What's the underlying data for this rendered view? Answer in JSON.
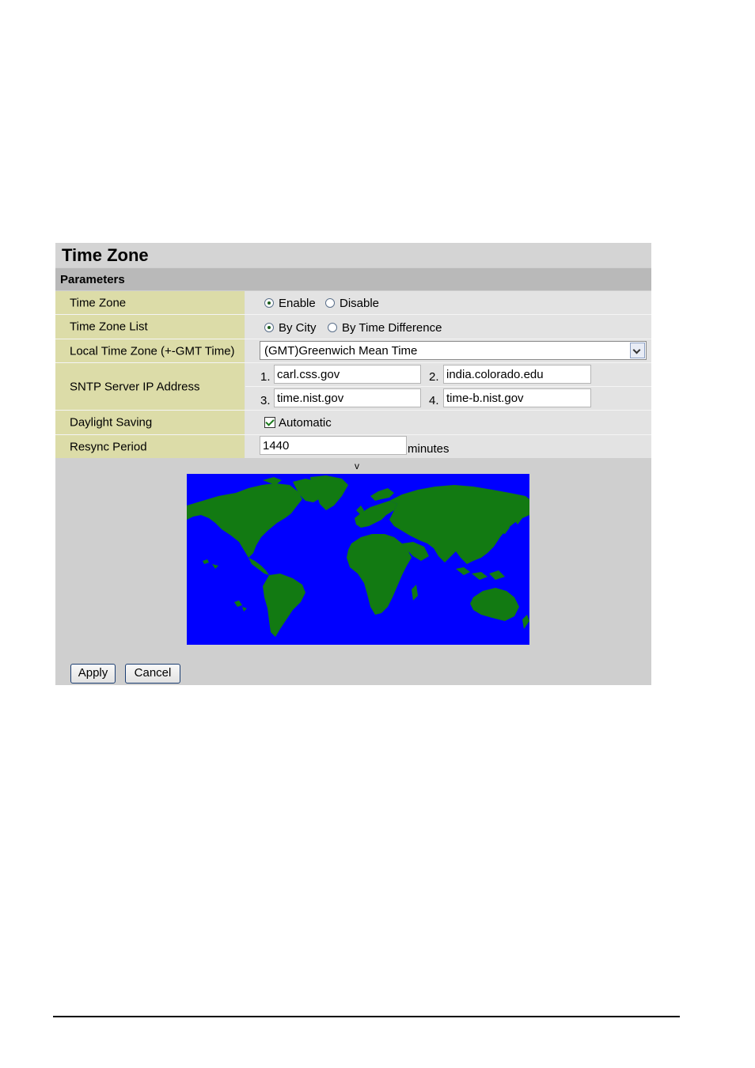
{
  "panel": {
    "title": "Time Zone",
    "section": "Parameters"
  },
  "rows": {
    "time_zone": {
      "label": "Time Zone",
      "options": [
        "Enable",
        "Disable"
      ],
      "selected": "Enable"
    },
    "time_zone_list": {
      "label": "Time Zone List",
      "options": [
        "By City",
        "By Time Difference"
      ],
      "selected": "By City"
    },
    "local_time_zone": {
      "label": "Local Time Zone (+-GMT Time)",
      "value": "(GMT)Greenwich Mean Time"
    },
    "sntp": {
      "label": "SNTP Server IP Address",
      "servers": [
        {
          "num": "1.",
          "value": "carl.css.gov"
        },
        {
          "num": "2.",
          "value": "india.colorado.edu"
        },
        {
          "num": "3.",
          "value": "time.nist.gov"
        },
        {
          "num": "4.",
          "value": "time-b.nist.gov"
        }
      ]
    },
    "daylight_saving": {
      "label": "Daylight Saving",
      "checkbox_label": "Automatic",
      "checked": true
    },
    "resync_period": {
      "label": "Resync Period",
      "value": "1440",
      "unit": "minutes"
    }
  },
  "map": {
    "marker": "v",
    "ocean_color": "#0000ff",
    "land_color": "#127a12"
  },
  "buttons": {
    "apply": "Apply",
    "cancel": "Cancel"
  }
}
